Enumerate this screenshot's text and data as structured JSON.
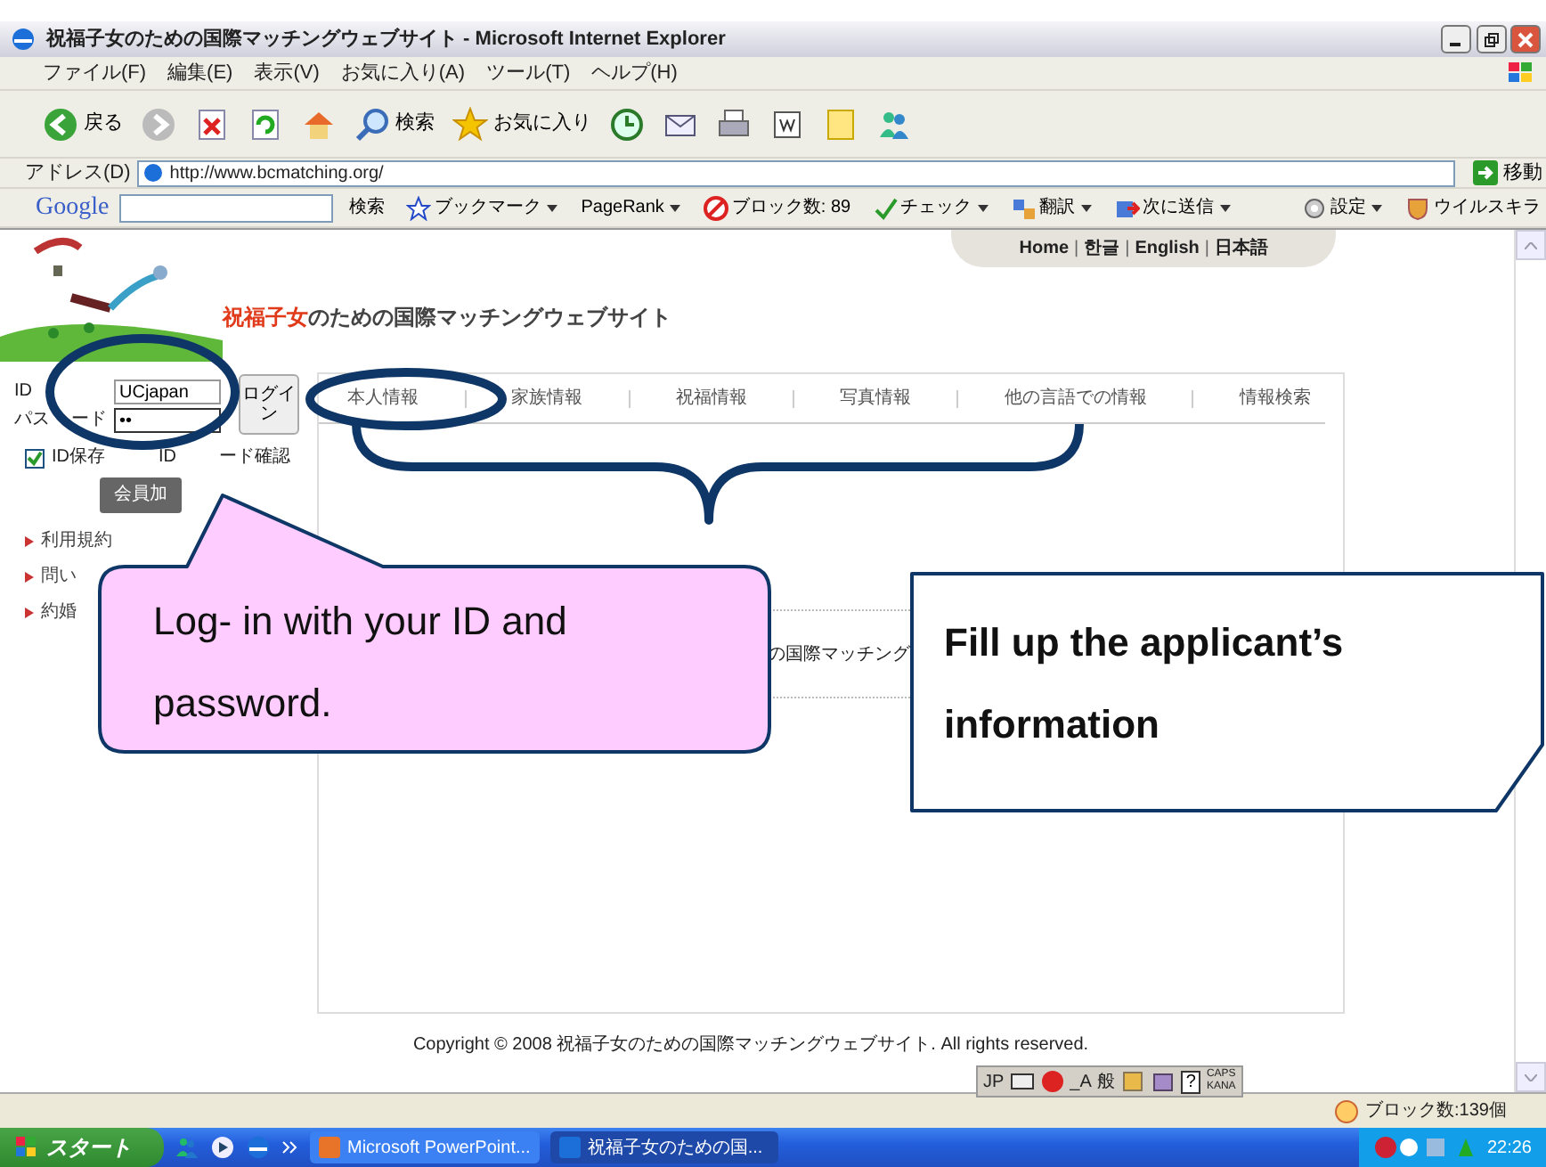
{
  "window": {
    "title": "祝福子女のための国際マッチングウェブサイト - Microsoft Internet Explorer"
  },
  "menu": [
    "ファイル(F)",
    "編集(E)",
    "表示(V)",
    "お気に入り(A)",
    "ツール(T)",
    "ヘルプ(H)"
  ],
  "toolbar": [
    {
      "kind": "back",
      "label": "戻る"
    },
    {
      "kind": "forward"
    },
    {
      "kind": "stop"
    },
    {
      "kind": "refresh"
    },
    {
      "kind": "home"
    },
    {
      "kind": "search",
      "label": "検索"
    },
    {
      "kind": "favorites",
      "label": "お気に入り"
    },
    {
      "kind": "history"
    },
    {
      "kind": "mail"
    },
    {
      "kind": "print"
    },
    {
      "kind": "edit"
    },
    {
      "kind": "note"
    },
    {
      "kind": "messenger"
    }
  ],
  "address": {
    "label": "アドレス(D)",
    "url": "http://www.bcmatching.org/",
    "go": "移動"
  },
  "google_toolbar": {
    "brand": "Google",
    "items": [
      {
        "kind": "search",
        "label": "検索"
      },
      {
        "kind": "bookmark",
        "label": "ブックマーク"
      },
      {
        "kind": "pagerank",
        "label": "PageRank"
      },
      {
        "kind": "block",
        "label": "ブロック数: 89"
      },
      {
        "kind": "check",
        "label": "チェック"
      },
      {
        "kind": "translate",
        "label": "翻訳"
      },
      {
        "kind": "send",
        "label": "次に送信"
      },
      {
        "kind": "settings",
        "label": "設定"
      },
      {
        "kind": "virus",
        "label": "ウイルスキラ"
      }
    ]
  },
  "site": {
    "top_links": [
      {
        "kind": "link",
        "label": "Home"
      },
      {
        "kind": "separator",
        "label": "|"
      },
      {
        "kind": "link",
        "label": "한글"
      },
      {
        "kind": "separator",
        "label": "|"
      },
      {
        "kind": "link",
        "label": "English"
      },
      {
        "kind": "separator",
        "label": "|"
      },
      {
        "kind": "link",
        "label": "日本語"
      }
    ],
    "title_accent": "祝福子女",
    "title_rest": "のための国際マッチングウェブサイト",
    "login": {
      "id_label": "ID",
      "id_value": "UCjapan",
      "pw_label_start": "パス",
      "pw_label_end": "ード",
      "pw_value": "••",
      "button": "ログイン",
      "remember": {
        "label": "ID保存",
        "checked": true
      },
      "recover_start": "ID",
      "recover_end": "ード確認",
      "join": "会員加"
    },
    "side_links": [
      "利用規約",
      "問い",
      "約婚"
    ],
    "tabs": [
      "本人情報",
      "家族情報",
      "祝福情報",
      "写真情報",
      "他の言語での情報",
      "情報検索"
    ],
    "snippet": "の国際マッチング",
    "copyright": "Copyright © 2008 祝福子女のための国際マッチングウェブサイト. All rights reserved."
  },
  "language_bar": [
    {
      "kind": "text",
      "label": "JP"
    },
    {
      "kind": "keyboard"
    },
    {
      "kind": "ime"
    },
    {
      "kind": "text",
      "label": "_A"
    },
    {
      "kind": "text",
      "label": "般"
    },
    {
      "kind": "dictionary"
    },
    {
      "kind": "tool"
    },
    {
      "kind": "help",
      "label": "?"
    },
    {
      "kind": "caps",
      "label": "CAPS"
    },
    {
      "kind": "caps",
      "label": "KANA"
    }
  ],
  "status_bar": "ブロック数:139個",
  "taskbar": {
    "start": "スタート",
    "tasks": [
      {
        "label": "Microsoft PowerPoint...",
        "selected": false
      },
      {
        "label": "祝福子女のための国...",
        "selected": true
      }
    ],
    "clock": "22:26"
  },
  "callouts": [
    {
      "kind": "pink",
      "text": "Log- in with your ID and password."
    },
    {
      "kind": "white",
      "text": "Fill up the applicant’s information"
    }
  ]
}
